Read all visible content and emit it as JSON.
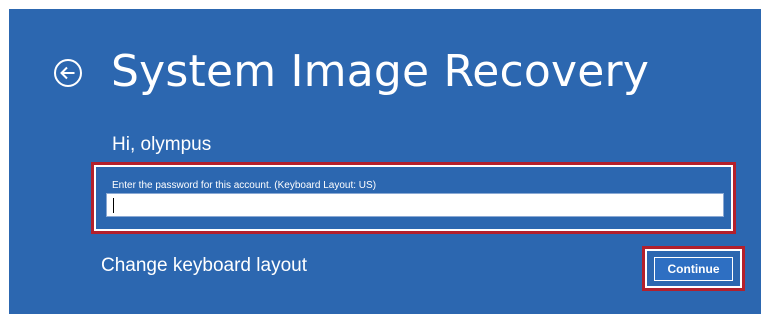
{
  "header": {
    "back_icon": "back-arrow-circle-icon",
    "title": "System Image Recovery"
  },
  "account": {
    "greeting": "Hi, olympus"
  },
  "password": {
    "label": "Enter the password for this account. (Keyboard Layout: US)",
    "value": ""
  },
  "actions": {
    "change_layout_label": "Change keyboard layout",
    "continue_label": "Continue"
  },
  "colors": {
    "background": "#2c67b0",
    "highlight": "#b3202c",
    "text": "#ffffff"
  }
}
